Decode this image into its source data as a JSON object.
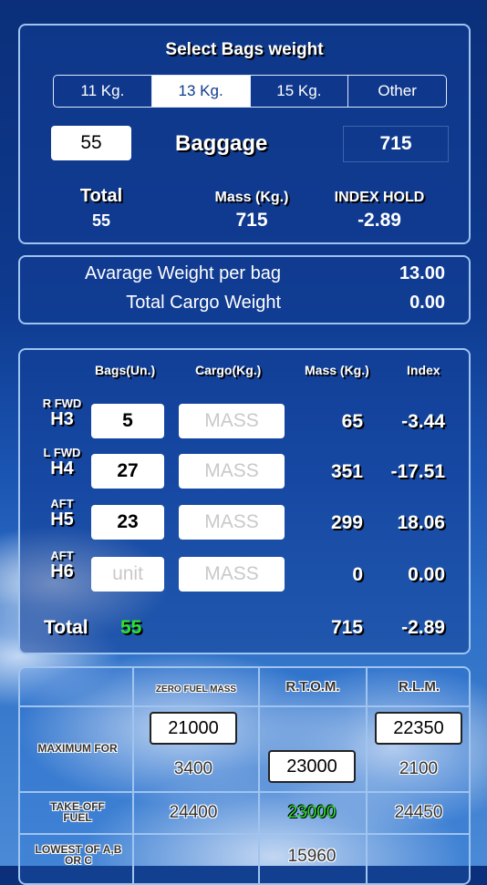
{
  "bag_weight": {
    "title": "Select Bags weight",
    "options": [
      "11 Kg.",
      "13 Kg.",
      "15 Kg.",
      "Other"
    ],
    "selected_index": 1,
    "bag_count": "55",
    "baggage_label": "Baggage",
    "baggage_mass": "715",
    "total_label": "Total",
    "total_value": "55",
    "mass_label": "Mass (Kg.)",
    "mass_value": "715",
    "index_label": "INDEX HOLD",
    "index_value": "-2.89"
  },
  "averages": {
    "avg_label": "Avarage Weight per bag",
    "avg_value": "13.00",
    "cargo_label": "Total Cargo Weight",
    "cargo_value": "0.00"
  },
  "holds": {
    "headers": {
      "bags": "Bags(Un.)",
      "cargo": "Cargo(Kg.)",
      "mass": "Mass (Kg.)",
      "index": "Index"
    },
    "rows": [
      {
        "pos": "R FWD",
        "name": "H3",
        "bags": "5",
        "cargo_placeholder": "MASS",
        "mass": "65",
        "index": "-3.44"
      },
      {
        "pos": "L FWD",
        "name": "H4",
        "bags": "27",
        "cargo_placeholder": "MASS",
        "mass": "351",
        "index": "-17.51"
      },
      {
        "pos": "AFT",
        "name": "H5",
        "bags": "23",
        "cargo_placeholder": "MASS",
        "mass": "299",
        "index": "18.06"
      },
      {
        "pos": "AFT",
        "name": "H6",
        "bags_placeholder": "unit",
        "cargo_placeholder": "MASS",
        "mass": "0",
        "index": "0.00"
      }
    ],
    "total_label": "Total",
    "total_bags": "55",
    "total_mass": "715",
    "total_index": "-2.89",
    "colors": {
      "total_bags": "#2ee02e"
    }
  },
  "limits": {
    "col_zfm": "ZERO FUEL MASS",
    "col_rtom": "R.T.O.M.",
    "col_rlm": "R.L.M.",
    "row_max": "MAXIMUM FOR",
    "row_takeoff": "TAKE-OFF FUEL",
    "row_lowest": "LOWEST OF A,B OR C",
    "zfm_max": "21000",
    "rlm_max": "22350",
    "zfm_sub": "3400",
    "rtom_max": "23000",
    "rlm_sub": "2100",
    "takeoff_zfm": "24400",
    "takeoff_rtom": "23000",
    "takeoff_rlm": "24450",
    "lowest_rtom": "15960",
    "colors": {
      "takeoff_rtom": "#2ee02e"
    }
  }
}
